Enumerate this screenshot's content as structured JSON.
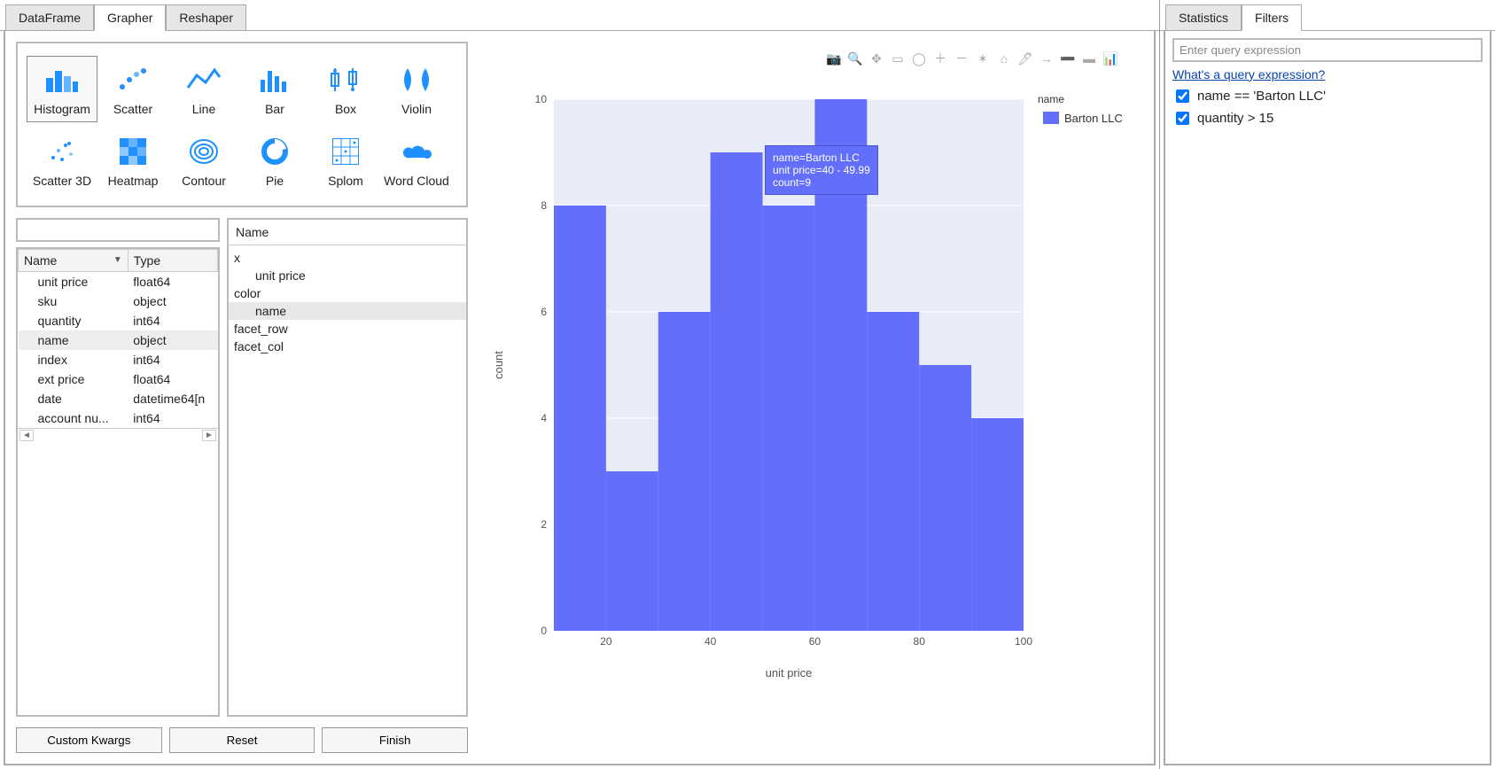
{
  "mainTabs": [
    "DataFrame",
    "Grapher",
    "Reshaper"
  ],
  "mainActive": 1,
  "rightTabs": [
    "Statistics",
    "Filters"
  ],
  "rightActive": 1,
  "chartTypes": [
    {
      "label": "Histogram",
      "icon": "histogram",
      "selected": true
    },
    {
      "label": "Scatter",
      "icon": "scatter"
    },
    {
      "label": "Line",
      "icon": "line"
    },
    {
      "label": "Bar",
      "icon": "bar"
    },
    {
      "label": "Box",
      "icon": "box"
    },
    {
      "label": "Violin",
      "icon": "violin"
    },
    {
      "label": "Scatter 3D",
      "icon": "scatter3d"
    },
    {
      "label": "Heatmap",
      "icon": "heatmap"
    },
    {
      "label": "Contour",
      "icon": "contour"
    },
    {
      "label": "Pie",
      "icon": "pie"
    },
    {
      "label": "Splom",
      "icon": "splom"
    },
    {
      "label": "Word Cloud",
      "icon": "wordcloud"
    }
  ],
  "columns": {
    "headers": {
      "name": "Name",
      "type": "Type"
    },
    "rows": [
      {
        "name": "unit price",
        "type": "float64"
      },
      {
        "name": "sku",
        "type": "object"
      },
      {
        "name": "quantity",
        "type": "int64"
      },
      {
        "name": "name",
        "type": "object",
        "selected": true
      },
      {
        "name": "index",
        "type": "int64"
      },
      {
        "name": "ext price",
        "type": "float64"
      },
      {
        "name": "date",
        "type": "datetime64[n"
      },
      {
        "name": "account nu...",
        "type": "int64"
      }
    ]
  },
  "searchPlaceholder": "",
  "dropzone": {
    "title": "Name",
    "slots": [
      {
        "key": "x",
        "label": "x",
        "child": "unit price"
      },
      {
        "key": "color",
        "label": "color",
        "child": "name",
        "childSelected": true
      },
      {
        "key": "facet_row",
        "label": "facet_row"
      },
      {
        "key": "facet_col",
        "label": "facet_col"
      }
    ]
  },
  "buttons": {
    "kwargs": "Custom Kwargs",
    "reset": "Reset",
    "finish": "Finish"
  },
  "chart_data": {
    "type": "bar",
    "xlabel": "unit price",
    "ylabel": "count",
    "x_ticks": [
      20,
      40,
      60,
      80,
      100
    ],
    "y_ticks": [
      2,
      4,
      6,
      8,
      10
    ],
    "xlim": [
      10,
      100
    ],
    "ylim": [
      0,
      10
    ],
    "bin_edges": [
      10,
      20,
      30,
      40,
      50,
      60,
      70,
      80,
      90,
      100
    ],
    "series": [
      {
        "name": "Barton LLC",
        "values": [
          8,
          3,
          6,
          9,
          8,
          10,
          6,
          5,
          4
        ]
      }
    ],
    "legend_title": "name"
  },
  "tooltip": {
    "series": "name=Barton LLC",
    "range": "unit price=40 - 49.99",
    "count": "count=9"
  },
  "modebar": [
    "camera",
    "zoom",
    "pan",
    "select",
    "lasso",
    "zoomin",
    "zoomout",
    "autoscale",
    "home",
    "stylus",
    "arrow",
    "minus",
    "bars",
    "plotly"
  ],
  "rightPanel": {
    "queryPlaceholder": "Enter query expression",
    "helpText": "What's a query expression?",
    "filters": [
      {
        "text": "name == 'Barton LLC'",
        "checked": true
      },
      {
        "text": "quantity > 15",
        "checked": true
      }
    ]
  }
}
